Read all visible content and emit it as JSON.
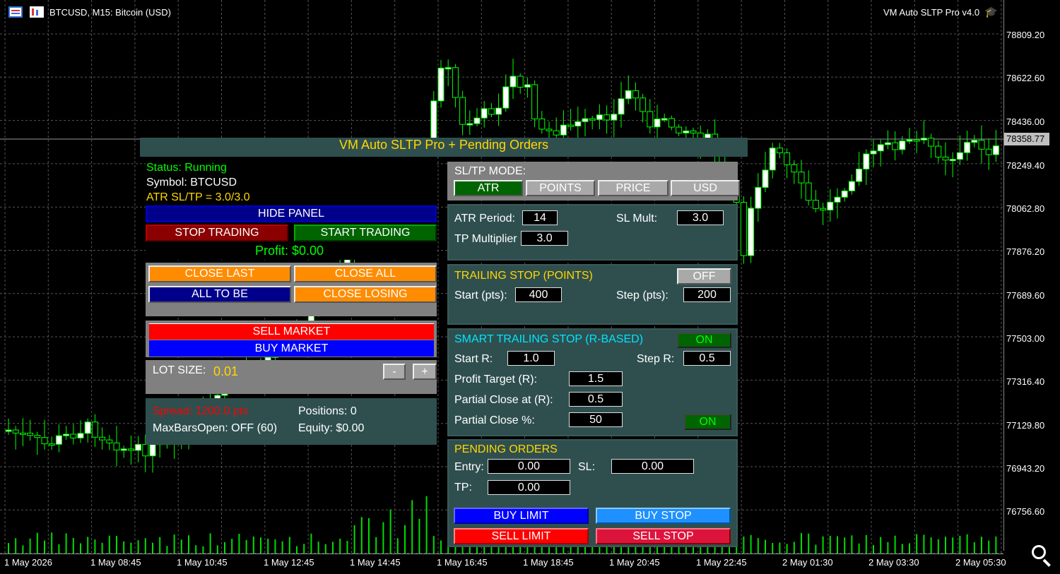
{
  "chart": {
    "title": "BTCUSD, M15:  Bitcoin (USD)",
    "indicator_name": "VM Auto SLTP Pro v4.0",
    "current_price": "78358.77",
    "price_labels": [
      "78809.20",
      "78622.60",
      "78436.00",
      "78249.40",
      "78062.80",
      "77876.20",
      "77689.60",
      "77503.00",
      "77316.40",
      "77129.80",
      "76943.20",
      "76756.60"
    ],
    "time_labels": [
      "1 May 2026",
      "1 May 08:45",
      "1 May 10:45",
      "1 May 12:45",
      "1 May 14:45",
      "1 May 16:45",
      "1 May 18:45",
      "1 May 20:45",
      "1 May 22:45",
      "2 May 01:30",
      "2 May 03:30",
      "2 May 05:30"
    ],
    "colors": {
      "bull": "#ffffff",
      "bear": "#000000",
      "wick": "#00ff00",
      "volume": "#00dd00",
      "grid": "#555555"
    }
  },
  "panel": {
    "title": "VM Auto SLTP Pro + Pending Orders",
    "status": "Status: Running",
    "symbol": "Symbol: BTCUSD",
    "atr_info": "ATR SL/TP = 3.0/3.0",
    "hide_panel": "HIDE PANEL",
    "stop_trading": "STOP TRADING",
    "start_trading": "START TRADING",
    "profit": "Profit: $0.00",
    "close_last": "CLOSE LAST",
    "close_all": "CLOSE ALL",
    "all_to_be": "ALL TO BE",
    "close_losing": "CLOSE LOSING",
    "sell_market": "SELL MARKET",
    "buy_market": "BUY MARKET",
    "lot_label": "LOT SIZE:",
    "lot_value": "0.01",
    "lot_minus": "-",
    "lot_plus": "+",
    "spread": "Spread: 1200.0 pts",
    "positions": "Positions: 0",
    "max_bars": "MaxBarsOpen: OFF (60)",
    "equity": "Equity: $0.00"
  },
  "sltp": {
    "mode_label": "SL/TP MODE:",
    "modes": [
      "ATR",
      "POINTS",
      "PRICE",
      "USD"
    ],
    "atr_period_label": "ATR Period:",
    "atr_period": "14",
    "sl_mult_label": "SL Mult:",
    "sl_mult": "3.0",
    "tp_mult_label": "TP Multiplier",
    "tp_mult": "3.0"
  },
  "trailing": {
    "title": "TRAILING STOP (POINTS)",
    "toggle": "OFF",
    "start_label": "Start (pts):",
    "start": "400",
    "step_label": "Step (pts):",
    "step": "200"
  },
  "smart": {
    "title": "SMART TRAILING STOP (R-BASED)",
    "toggle": "ON",
    "start_r_label": "Start R:",
    "start_r": "1.0",
    "step_r_label": "Step R:",
    "step_r": "0.5",
    "profit_target_label": "Profit Target (R):",
    "profit_target": "1.5",
    "partial_at_label": "Partial Close at (R):",
    "partial_at": "0.5",
    "partial_pct_label": "Partial Close %:",
    "partial_pct": "50",
    "partial_toggle": "ON"
  },
  "pending": {
    "title": "PENDING ORDERS",
    "entry_label": "Entry:",
    "entry": "0.00",
    "sl_label": "SL:",
    "sl": "0.00",
    "tp_label": "TP:",
    "tp": "0.00",
    "buy_limit": "BUY LIMIT",
    "buy_stop": "BUY STOP",
    "sell_limit": "SELL LIMIT",
    "sell_stop": "SELL STOP"
  }
}
